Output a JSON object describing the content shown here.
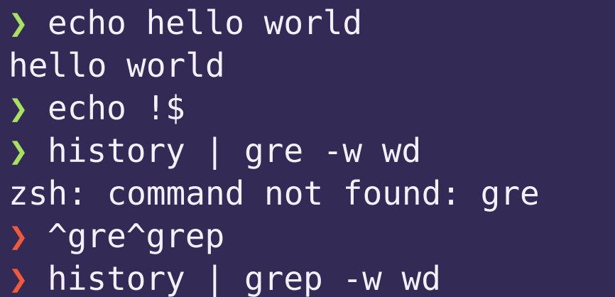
{
  "prompt_symbol": "❯",
  "colors": {
    "background": "#332b55",
    "text": "#f4f1ff",
    "prompt_success": "#a8e05f",
    "prompt_error": "#f05a3b"
  },
  "lines": [
    {
      "type": "command",
      "status": "success",
      "text": "echo hello world"
    },
    {
      "type": "output",
      "text": "hello world"
    },
    {
      "type": "command",
      "status": "success",
      "text": "echo !$"
    },
    {
      "type": "command",
      "status": "success",
      "text": "history | gre -w wd"
    },
    {
      "type": "output",
      "text": "zsh: command not found: gre"
    },
    {
      "type": "command",
      "status": "error",
      "text": "^gre^grep"
    },
    {
      "type": "command",
      "status": "error",
      "text": "history | grep -w wd"
    }
  ]
}
